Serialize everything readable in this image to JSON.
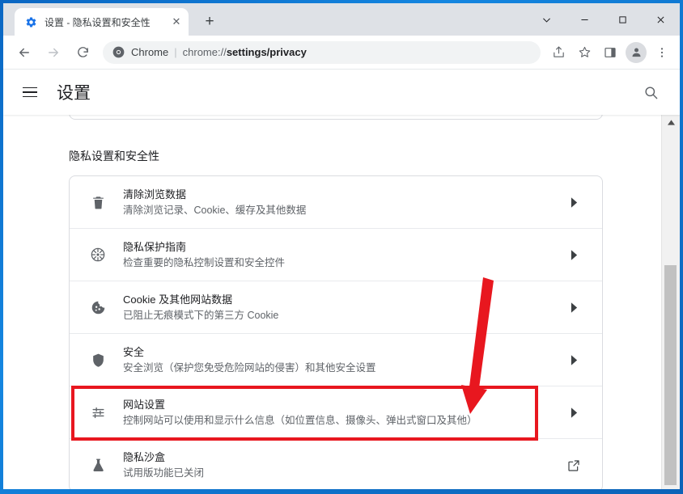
{
  "window": {
    "controls": [
      {
        "name": "tab-search",
        "glyph": "∨"
      },
      {
        "name": "minimize",
        "glyph": "—"
      },
      {
        "name": "maximize",
        "glyph": "□"
      },
      {
        "name": "close",
        "glyph": "✕"
      }
    ]
  },
  "tab": {
    "title": "设置 - 隐私设置和安全性",
    "favicon": "gear-icon",
    "close_label": "✕",
    "new_tab_label": "+"
  },
  "toolbar": {
    "back_label": "←",
    "forward_label": "→",
    "reload_label": "⟳",
    "omnibox": {
      "icon": "chrome-logo-icon",
      "scheme_label": "Chrome",
      "separator": "|",
      "url_prefix": "chrome://",
      "url_bold": "settings/privacy"
    },
    "share_label": "share-icon",
    "bookmark_label": "☆",
    "side_panel_label": "side-panel-icon",
    "profile_label": "avatar-icon",
    "menu_label": "⋮"
  },
  "settings": {
    "menu_label": "hamburger-menu",
    "title": "设置",
    "search_label": "search-icon"
  },
  "page": {
    "section_title": "隐私设置和安全性",
    "rows": [
      {
        "icon": "trash-icon",
        "title": "清除浏览数据",
        "subtitle": "清除浏览记录、Cookie、缓存及其他数据",
        "action": "chevron-right-icon"
      },
      {
        "icon": "privacy-guide-icon",
        "title": "隐私保护指南",
        "subtitle": "检查重要的隐私控制设置和安全控件",
        "action": "chevron-right-icon"
      },
      {
        "icon": "cookie-icon",
        "title": "Cookie 及其他网站数据",
        "subtitle": "已阻止无痕模式下的第三方 Cookie",
        "action": "chevron-right-icon"
      },
      {
        "icon": "shield-icon",
        "title": "安全",
        "subtitle": "安全浏览（保护您免受危险网站的侵害）和其他安全设置",
        "action": "chevron-right-icon"
      },
      {
        "icon": "tune-sliders-icon",
        "title": "网站设置",
        "subtitle": "控制网站可以使用和显示什么信息（如位置信息、摄像头、弹出式窗口及其他）",
        "action": "chevron-right-icon"
      },
      {
        "icon": "flask-icon",
        "title": "隐私沙盒",
        "subtitle": "试用版功能已关闭",
        "action": "open-in-new-icon"
      }
    ]
  },
  "annotations": {
    "highlight_color": "#e8171f",
    "box_target_row_index": 4,
    "arrow": "down-left-arrow"
  },
  "scrollbar": {
    "up_label": "▲",
    "down_label": "▼"
  }
}
